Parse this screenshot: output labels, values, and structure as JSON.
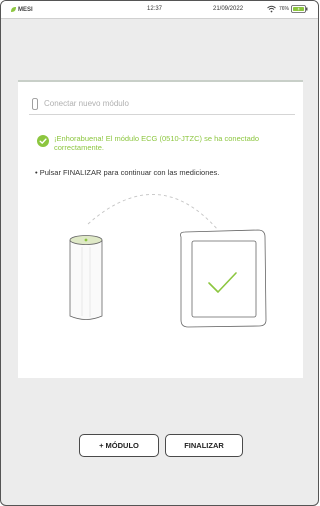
{
  "status_bar": {
    "brand": "MESI",
    "time": "12:37",
    "date": "21/09/2022",
    "battery_percent": "76%",
    "brand_color": "#8cc63f"
  },
  "connect": {
    "placeholder": "Conectar nuevo módulo",
    "success_message": "¡Enhorabuena! El módulo ECG (0510-JTZC) se ha conectado correctamente.",
    "instruction": "• Pulsar FINALIZAR para continuar con las mediciones.",
    "success_color": "#8cc63f"
  },
  "icons": {
    "brand": "leaf-icon",
    "wifi": "wifi-icon",
    "battery": "battery-icon",
    "module": "module-device-icon",
    "success": "checkmark-circle-icon",
    "tablet": "tablet-icon"
  },
  "actions": {
    "add_module_label": "+ MÓDULO",
    "finish_label": "FINALIZAR"
  }
}
